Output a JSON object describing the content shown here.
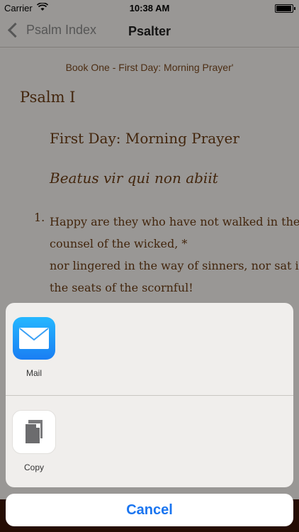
{
  "status_bar": {
    "carrier": "Carrier",
    "time": "10:38 AM",
    "battery_level": 0.95
  },
  "nav": {
    "back_label": "Psalm Index",
    "title": "Psalter"
  },
  "content": {
    "book_heading": "Book One - First Day: Morning Prayer'",
    "psalm_title": "Psalm I",
    "day_title": "First Day: Morning Prayer",
    "latin_title": "Beatus vir qui non abiit",
    "verse_number": "1.",
    "verse_lines": [
      "Happy are they who have not walked in the",
      "counsel of the wicked, *",
      "nor lingered in the way of sinners, nor sat in",
      "the seats of the scornful!"
    ]
  },
  "share_sheet": {
    "apps": [
      {
        "label": "Mail",
        "icon": "mail-icon"
      },
      {
        "label": "Copy",
        "icon": "copy-icon"
      }
    ],
    "cancel_label": "Cancel"
  },
  "colors": {
    "accent": "#1a75f0",
    "text_brown": "#6b3c14",
    "mail_blue": "#1a7ef3"
  }
}
